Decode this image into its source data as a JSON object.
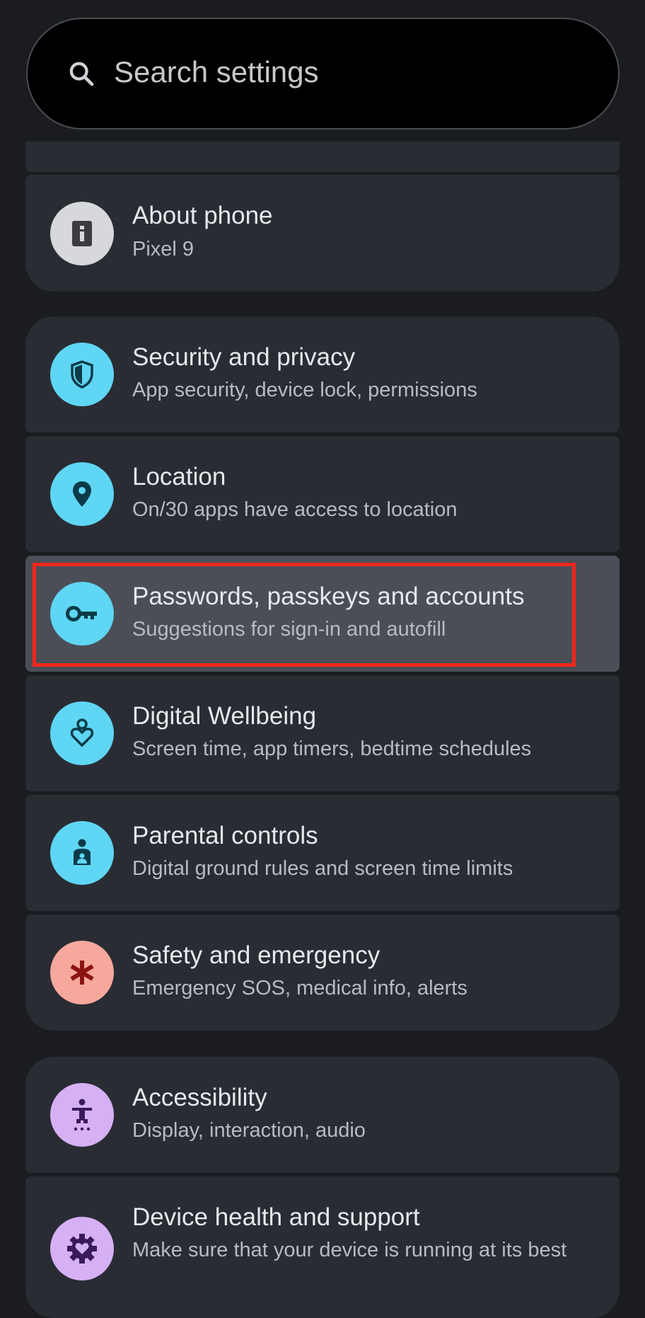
{
  "search": {
    "placeholder": "Search settings"
  },
  "items": [
    {
      "id": "about-phone",
      "title": "About phone",
      "subtitle": "Pixel 9",
      "icon": "phone-info-icon",
      "color": "#d7d8db"
    },
    {
      "id": "security-privacy",
      "title": "Security and privacy",
      "subtitle": "App security, device lock, permissions",
      "icon": "shield-icon",
      "color": "#5fd6f3"
    },
    {
      "id": "location",
      "title": "Location",
      "subtitle": "On/30 apps have access to location",
      "icon": "location-pin-icon",
      "color": "#5fd6f3"
    },
    {
      "id": "passwords-accounts",
      "title": "Passwords, passkeys and accounts",
      "subtitle": "Suggestions for sign-in and autofill",
      "icon": "key-icon",
      "color": "#5fd6f3"
    },
    {
      "id": "digital-wellbeing",
      "title": "Digital Wellbeing",
      "subtitle": "Screen time, app timers, bedtime schedules",
      "icon": "wellbeing-icon",
      "color": "#5fd6f3"
    },
    {
      "id": "parental-controls",
      "title": "Parental controls",
      "subtitle": "Digital ground rules and screen time limits",
      "icon": "parental-icon",
      "color": "#5fd6f3"
    },
    {
      "id": "safety-emergency",
      "title": "Safety and emergency",
      "subtitle": "Emergency SOS, medical info, alerts",
      "icon": "asterisk-icon",
      "color": "#f6a89c"
    },
    {
      "id": "accessibility",
      "title": "Accessibility",
      "subtitle": "Display, interaction, audio",
      "icon": "accessibility-icon",
      "color": "#d6b0f5"
    },
    {
      "id": "device-health",
      "title": "Device health and support",
      "subtitle": "Make sure that your device is running at its best",
      "icon": "gear-heart-icon",
      "color": "#d6b0f5"
    }
  ]
}
